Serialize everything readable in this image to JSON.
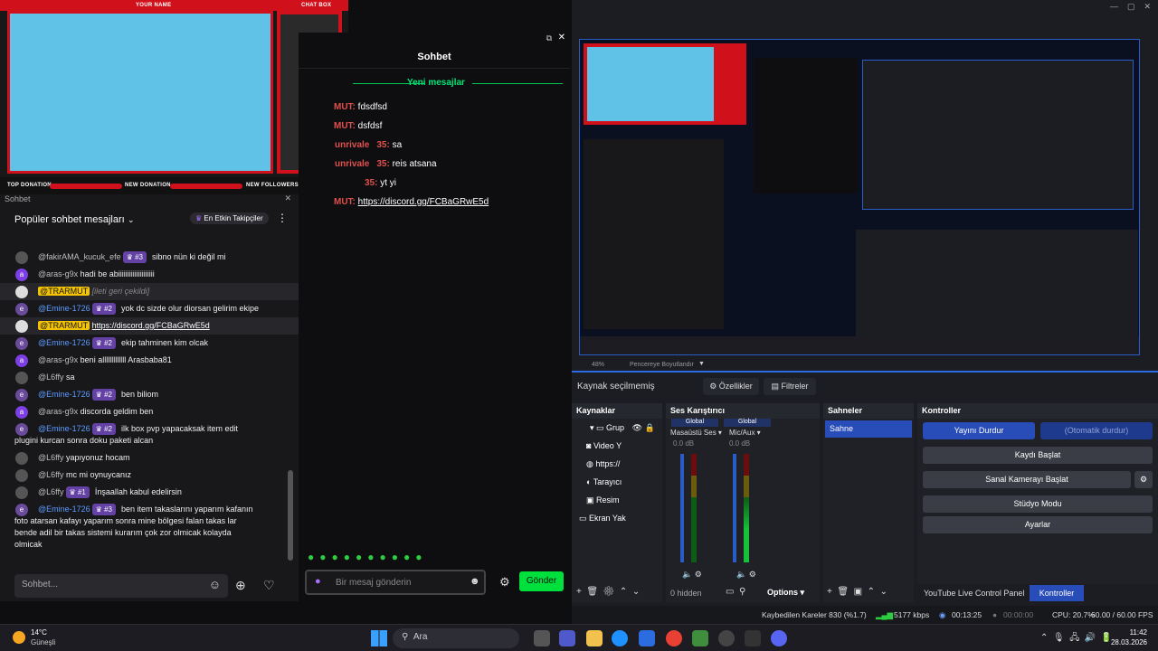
{
  "overlay": {
    "your_name": "YOUR NAME",
    "chat_box": "CHAT BOX",
    "top_donation": "TOP DONATION",
    "new_donation": "NEW DONATION",
    "new_followers": "NEW FOLLOWERS"
  },
  "chat": {
    "title": "Sohbet",
    "popular_title": "Popüler sohbet mesajları",
    "top_followers": "En Etkin Takipçiler",
    "input_placeholder": "Sohbet...",
    "messages": [
      {
        "user": "@fakirAMA_kucuk_efe",
        "badge": "#3",
        "text": "sibno nün ki değil mi"
      },
      {
        "user": "@aras-g9x",
        "text": "hadi be abiiiiiiiiiiiiiiiiiiii"
      },
      {
        "user": "@TRARMUT",
        "deleted": "[ileti geri çekildi]"
      },
      {
        "user": "@Emine-1726",
        "badge": "#2",
        "text": "yok dc sizde olur diorsan gelirim ekipe"
      },
      {
        "user": "@TRARMUT",
        "link": "https://discord.gg/FCBaGRwE5d"
      },
      {
        "user": "@Emine-1726",
        "badge": "#2",
        "text": "ekip tahminen kim olcak"
      },
      {
        "user": "@aras-g9x",
        "text": "beni alllllllllllll Arasbaba81"
      },
      {
        "user": "@L6ffy",
        "text": "sa"
      },
      {
        "user": "@Emine-1726",
        "badge": "#2",
        "text": "ben biliom"
      },
      {
        "user": "@aras-g9x",
        "text": "discorda geldim ben"
      },
      {
        "user": "@Emine-1726",
        "badge": "#2",
        "text": "ilk box pvp yapacaksak item edit",
        "text2": "plugini kurcan sonra doku paketi alcan"
      },
      {
        "user": "@L6ffy",
        "text": "yapıyonuz hocam"
      },
      {
        "user": "@L6ffy",
        "text": "mc mi oynuycanız"
      },
      {
        "user": "@L6ffy",
        "badge": "#1",
        "text": "İnşaallah kabul edelirsin"
      },
      {
        "user": "@Emine-1726",
        "badge": "#3",
        "text": "ben item takaslarını yaparım kafanın",
        "text2": "foto atarsan kafayı yaparım sonra mine bölgesi falan takas lar",
        "text3": "bende adil bir takas sistemi kurarım çok zor olmicak kolayda",
        "text4": "olmicak"
      }
    ]
  },
  "midchat": {
    "title": "Sohbet",
    "new_messages": "Yeni mesajlar",
    "lines": [
      {
        "user": "MUT:",
        "text": "fdsdfsd"
      },
      {
        "user": "MUT:",
        "text": "dsfdsf"
      },
      {
        "user": "unrivale",
        "user2": "35:",
        "text": "sa"
      },
      {
        "user": "unrivale",
        "user2": "35:",
        "text": "reis atsana"
      },
      {
        "user": "",
        "user2": "35:",
        "text": "yt yi"
      },
      {
        "user": "MUT:",
        "link": "https://discord.gg/FCBaGRwE5d"
      }
    ],
    "input_placeholder": "Bir mesaj gönderin",
    "send": "Gönder"
  },
  "obs": {
    "zoom": "48%",
    "fit": "Pencereye Boyutlandır",
    "no_source": "Kaynak seçilmemiş",
    "properties": "Özellikler",
    "filters": "Filtreler",
    "sources_title": "Kaynaklar",
    "sources": [
      "Grup",
      "Video Y",
      "https://",
      "Tarayıcı",
      "Resim",
      "Ekran Yak"
    ],
    "mixer_title": "Ses Karıştırıcı",
    "global": "Global",
    "ch1": "Masaüstü Ses",
    "ch2": "Mic/Aux",
    "db": "0.0 dB",
    "hidden": "0 hidden",
    "options": "Options",
    "scenes_title": "Sahneler",
    "scene": "Sahne",
    "controls_title": "Kontroller",
    "stop_stream": "Yayını Durdur",
    "auto_stop": "(Otomatik durdur)",
    "record": "Kaydı Başlat",
    "vcam": "Sanal Kamerayı Başlat",
    "studio": "Stüdyo Modu",
    "settings": "Ayarlar",
    "tab1": "YouTube Live Control Panel",
    "tab2": "Kontroller",
    "status_dropped": "Kaybedilen Kareler 830 (%1.7)",
    "status_kbps": "5177 kbps",
    "status_time": "00:13:25",
    "status_rec": "00:00:00",
    "status_cpu": "CPU: 20.7%",
    "status_fps": "60.00 / 60.00 FPS"
  },
  "taskbar": {
    "temp": "14°C",
    "weather": "Güneşli",
    "search": "Ara",
    "time": "11:42",
    "date": "28.03.2026"
  },
  "colors": {
    "red": "#d0111c",
    "cyan": "#5fc2e6",
    "green": "#00c853",
    "purple": "#6441a5",
    "obsblue": "#284cb8"
  }
}
